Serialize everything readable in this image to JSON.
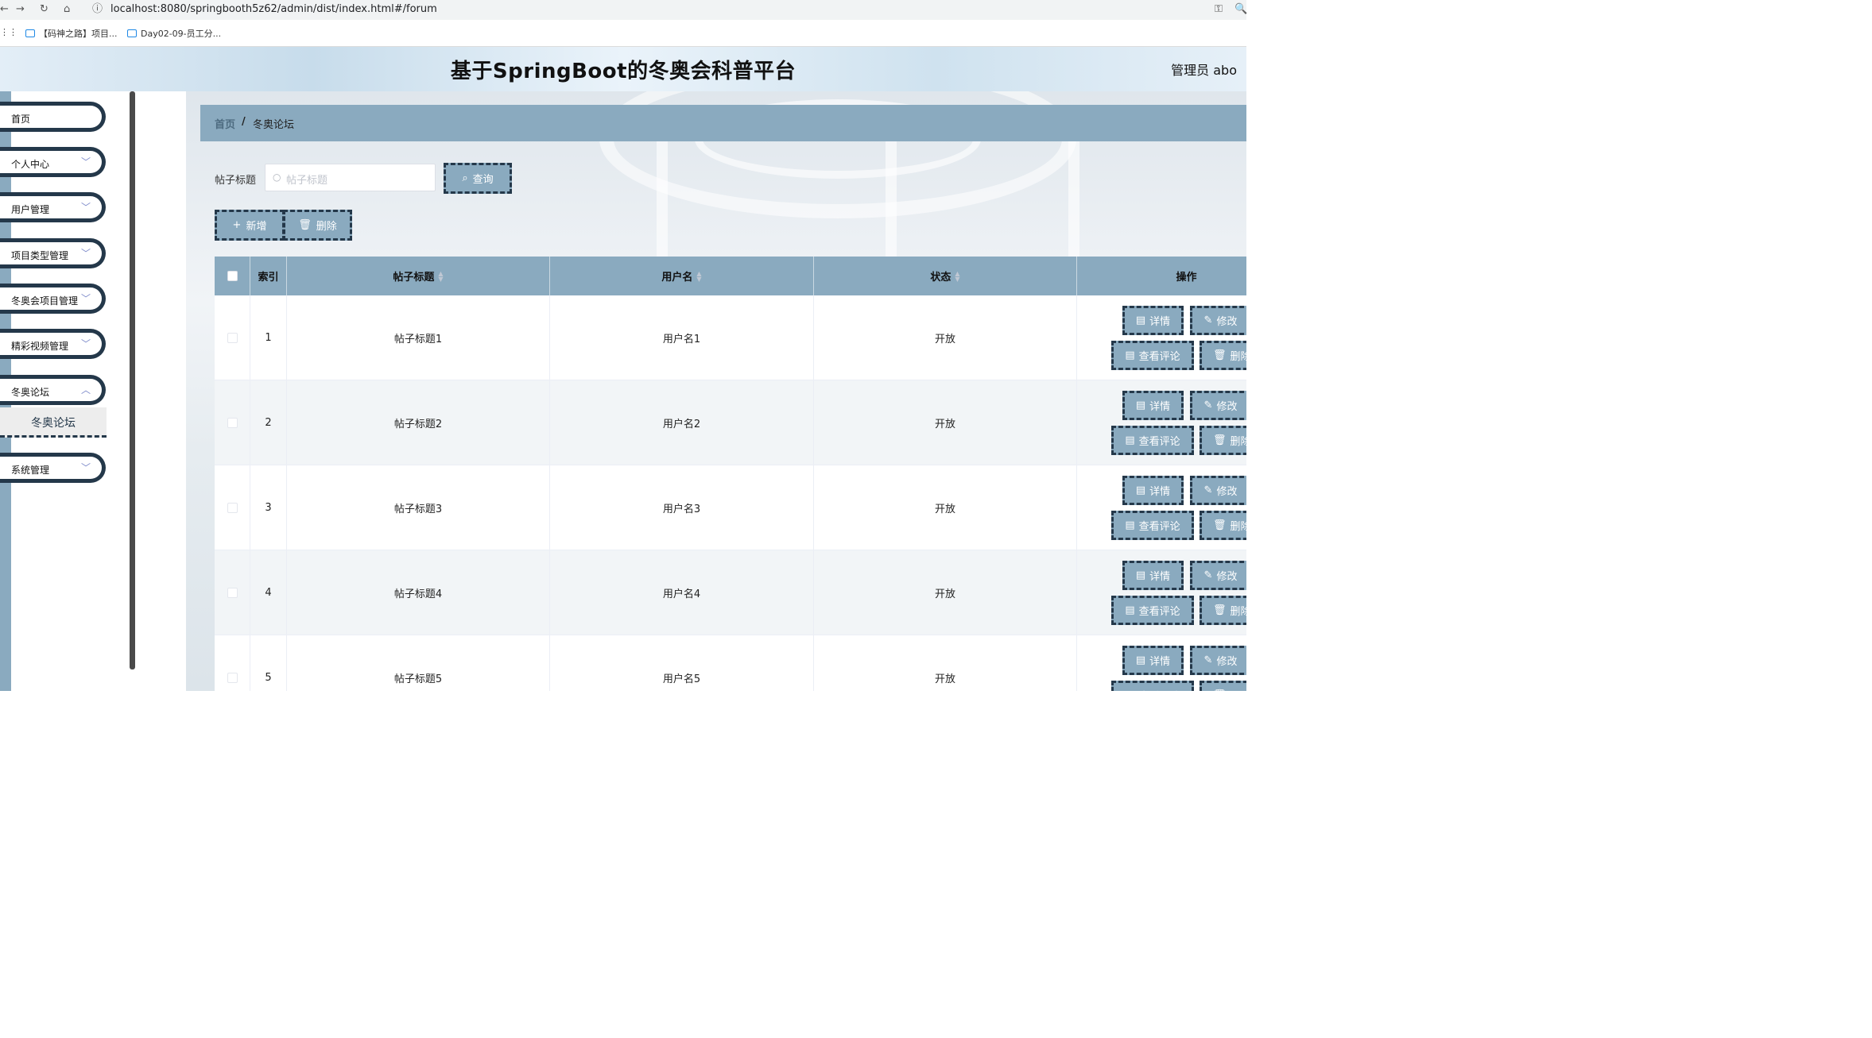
{
  "browser": {
    "url": "localhost:8080/springbooth5z62/admin/dist/index.html#/forum",
    "bookmarks": [
      "【码神之路】项目...",
      "Day02-09-员工分..."
    ]
  },
  "header": {
    "title": "基于SpringBoot的冬奥会科普平台",
    "user": "管理员 abo"
  },
  "sidebar": {
    "items": [
      {
        "label": "首页"
      },
      {
        "label": "个人中心"
      },
      {
        "label": "用户管理"
      },
      {
        "label": "项目类型管理"
      },
      {
        "label": "冬奥会项目管理"
      },
      {
        "label": "精彩视频管理"
      },
      {
        "label": "冬奥论坛"
      },
      {
        "label": "系统管理"
      }
    ],
    "active_sub": "冬奥论坛"
  },
  "breadcrumb": {
    "home": "首页",
    "sep": "/",
    "current": "冬奥论坛"
  },
  "search": {
    "label": "帖子标题",
    "placeholder": "帖子标题",
    "query_button": "查询"
  },
  "toolbar": {
    "add": "新增",
    "delete": "删除"
  },
  "table": {
    "columns": {
      "index": "索引",
      "title": "帖子标题",
      "user": "用户名",
      "status": "状态",
      "ops": "操作"
    },
    "rows": [
      {
        "index": "1",
        "title": "帖子标题1",
        "user": "用户名1",
        "status": "开放"
      },
      {
        "index": "2",
        "title": "帖子标题2",
        "user": "用户名2",
        "status": "开放"
      },
      {
        "index": "3",
        "title": "帖子标题3",
        "user": "用户名3",
        "status": "开放"
      },
      {
        "index": "4",
        "title": "帖子标题4",
        "user": "用户名4",
        "status": "开放"
      },
      {
        "index": "5",
        "title": "帖子标题5",
        "user": "用户名5",
        "status": "开放"
      }
    ],
    "actions": {
      "detail": "详情",
      "edit": "修改",
      "comments": "查看评论",
      "delete": "删除"
    }
  },
  "colors": {
    "accent": "#8aaabf",
    "dark": "#24384a"
  }
}
